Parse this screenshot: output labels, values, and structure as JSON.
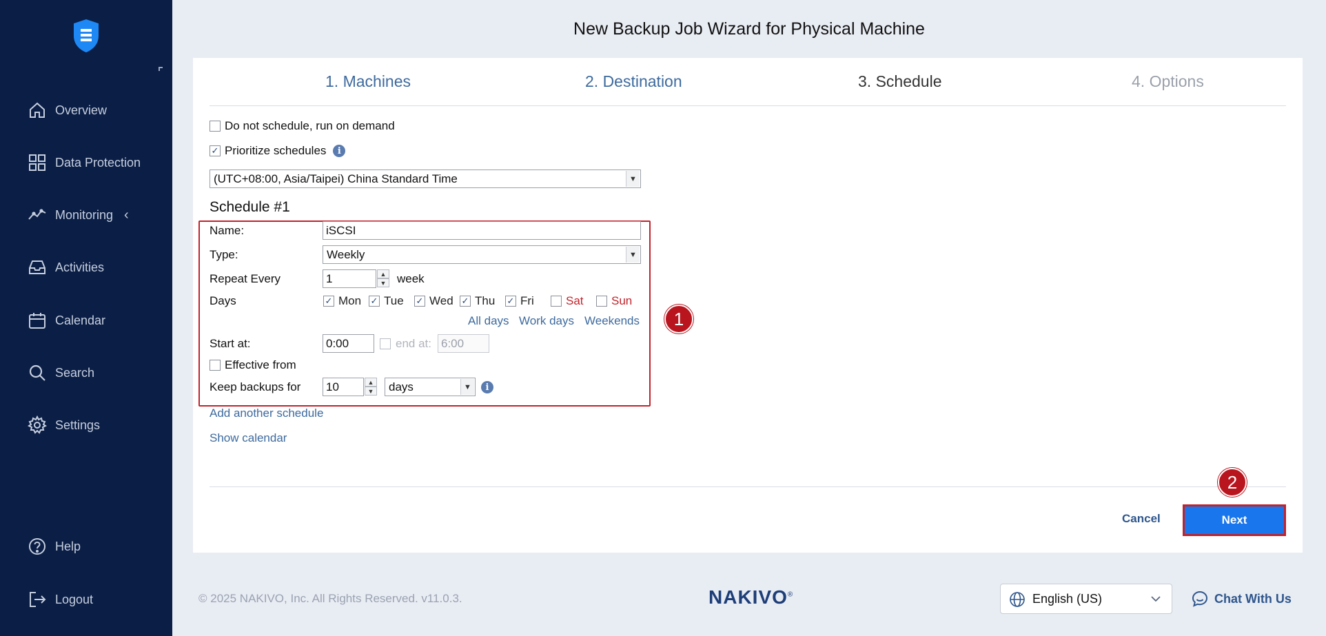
{
  "window": {
    "title": "New Backup Job Wizard for Physical Machine"
  },
  "sidebar": {
    "items": [
      {
        "label": "Overview",
        "icon": "home-icon"
      },
      {
        "label": "Data Protection",
        "icon": "grid-icon"
      },
      {
        "label": "Monitoring",
        "icon": "chart-line-icon"
      },
      {
        "label": "Activities",
        "icon": "inbox-icon"
      },
      {
        "label": "Calendar",
        "icon": "calendar-icon"
      },
      {
        "label": "Search",
        "icon": "search-icon"
      },
      {
        "label": "Settings",
        "icon": "gear-icon"
      }
    ],
    "bottom": [
      {
        "label": "Help",
        "icon": "help-icon"
      },
      {
        "label": "Logout",
        "icon": "logout-icon"
      }
    ]
  },
  "steps": [
    {
      "label": "1. Machines",
      "state": "done"
    },
    {
      "label": "2. Destination",
      "state": "done"
    },
    {
      "label": "3. Schedule",
      "state": "current"
    },
    {
      "label": "4. Options",
      "state": "future"
    }
  ],
  "form": {
    "do_not_schedule": {
      "label": "Do not schedule, run on demand",
      "checked": false
    },
    "prioritize": {
      "label": "Prioritize schedules",
      "checked": true
    },
    "timezone": "(UTC+08:00, Asia/Taipei) China Standard Time",
    "schedule_title": "Schedule #1",
    "name_label": "Name:",
    "name_value": "iSCSI",
    "type_label": "Type:",
    "type_value": "Weekly",
    "repeat_label": "Repeat Every",
    "repeat_value": "1",
    "repeat_unit": "week",
    "days_label": "Days",
    "days": [
      {
        "label": "Mon",
        "checked": true
      },
      {
        "label": "Tue",
        "checked": true
      },
      {
        "label": "Wed",
        "checked": true
      },
      {
        "label": "Thu",
        "checked": true
      },
      {
        "label": "Fri",
        "checked": true
      },
      {
        "label": "Sat",
        "checked": false
      },
      {
        "label": "Sun",
        "checked": false
      }
    ],
    "day_links": [
      "All days",
      "Work days",
      "Weekends"
    ],
    "start_label": "Start at:",
    "start_value": "0:00",
    "end_label": "end at:",
    "end_value": "6:00",
    "effective_label": "Effective from",
    "keep_label": "Keep backups for",
    "keep_value": "10",
    "keep_unit": "days",
    "add_schedule": "Add another schedule",
    "show_calendar": "Show calendar"
  },
  "buttons": {
    "cancel": "Cancel",
    "next": "Next"
  },
  "badges": [
    "1",
    "2"
  ],
  "footer": {
    "copyright": "© 2025 NAKIVO, Inc. All Rights Reserved. v11.0.3.",
    "brand": "NAKIVO",
    "brand_mark": "®",
    "language": "English (US)",
    "chat": "Chat With Us"
  },
  "colors": {
    "sidebar_bg": "#0b1e45",
    "accent": "#1976ec",
    "highlight": "#c2222b",
    "link": "#3d6a9e"
  }
}
